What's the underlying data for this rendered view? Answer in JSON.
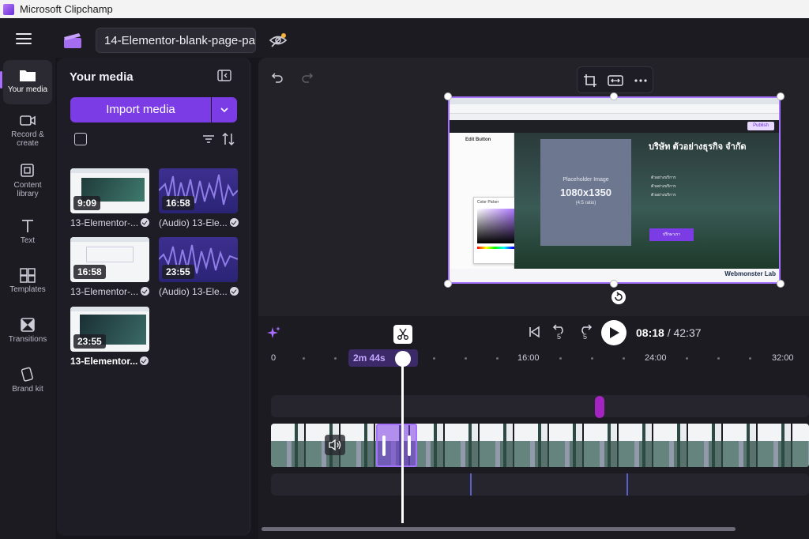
{
  "window": {
    "title": "Microsoft Clipchamp"
  },
  "header": {
    "project_name": "14-Elementor-blank-page-pa"
  },
  "rail": {
    "items": [
      {
        "label": "Your media",
        "icon": "folder-icon"
      },
      {
        "label": "Record & create",
        "icon": "camera-icon"
      },
      {
        "label": "Content library",
        "icon": "library-icon"
      },
      {
        "label": "Text",
        "icon": "text-icon"
      },
      {
        "label": "Templates",
        "icon": "templates-icon"
      },
      {
        "label": "Transitions",
        "icon": "transitions-icon"
      },
      {
        "label": "Brand kit",
        "icon": "brand-kit-icon"
      }
    ]
  },
  "media": {
    "title": "Your media",
    "import_label": "Import media",
    "items": [
      {
        "type": "video",
        "duration": "9:09",
        "label": "13-Elementor-..."
      },
      {
        "type": "audio",
        "duration": "16:58",
        "label": "(Audio) 13-Ele..."
      },
      {
        "type": "video",
        "duration": "16:58",
        "label": "13-Elementor-..."
      },
      {
        "type": "audio",
        "duration": "23:55",
        "label": "(Audio) 13-Ele..."
      },
      {
        "type": "video",
        "duration": "23:55",
        "label": "13-Elementor..."
      }
    ]
  },
  "preview": {
    "placeholder_title": "Placeholder Image",
    "placeholder_size": "1080x1350",
    "placeholder_ratio": "(4:5 ratio)",
    "heading_thai": "บริษัท ตัวอย่างธุรกิจ จำกัด",
    "brand": "Webmonster Lab",
    "publish": "Publish",
    "panel_title": "Edit Button",
    "color_picker": "Color Picker",
    "button_text": "ปรึกษาเรา",
    "list_item": "ตัวอย่างบริการ"
  },
  "playback": {
    "current_time": "08:18",
    "total_time": "/ 42:37",
    "playhead_label": "2m 44s",
    "skip_back_label": "5",
    "skip_fwd_label": "5"
  },
  "ruler": {
    "labels": [
      "0",
      "16:00",
      "24:00",
      "32:00"
    ]
  },
  "colors": {
    "accent": "#7b3ce6",
    "selection": "#a571ff",
    "marker": "#a324c0"
  }
}
